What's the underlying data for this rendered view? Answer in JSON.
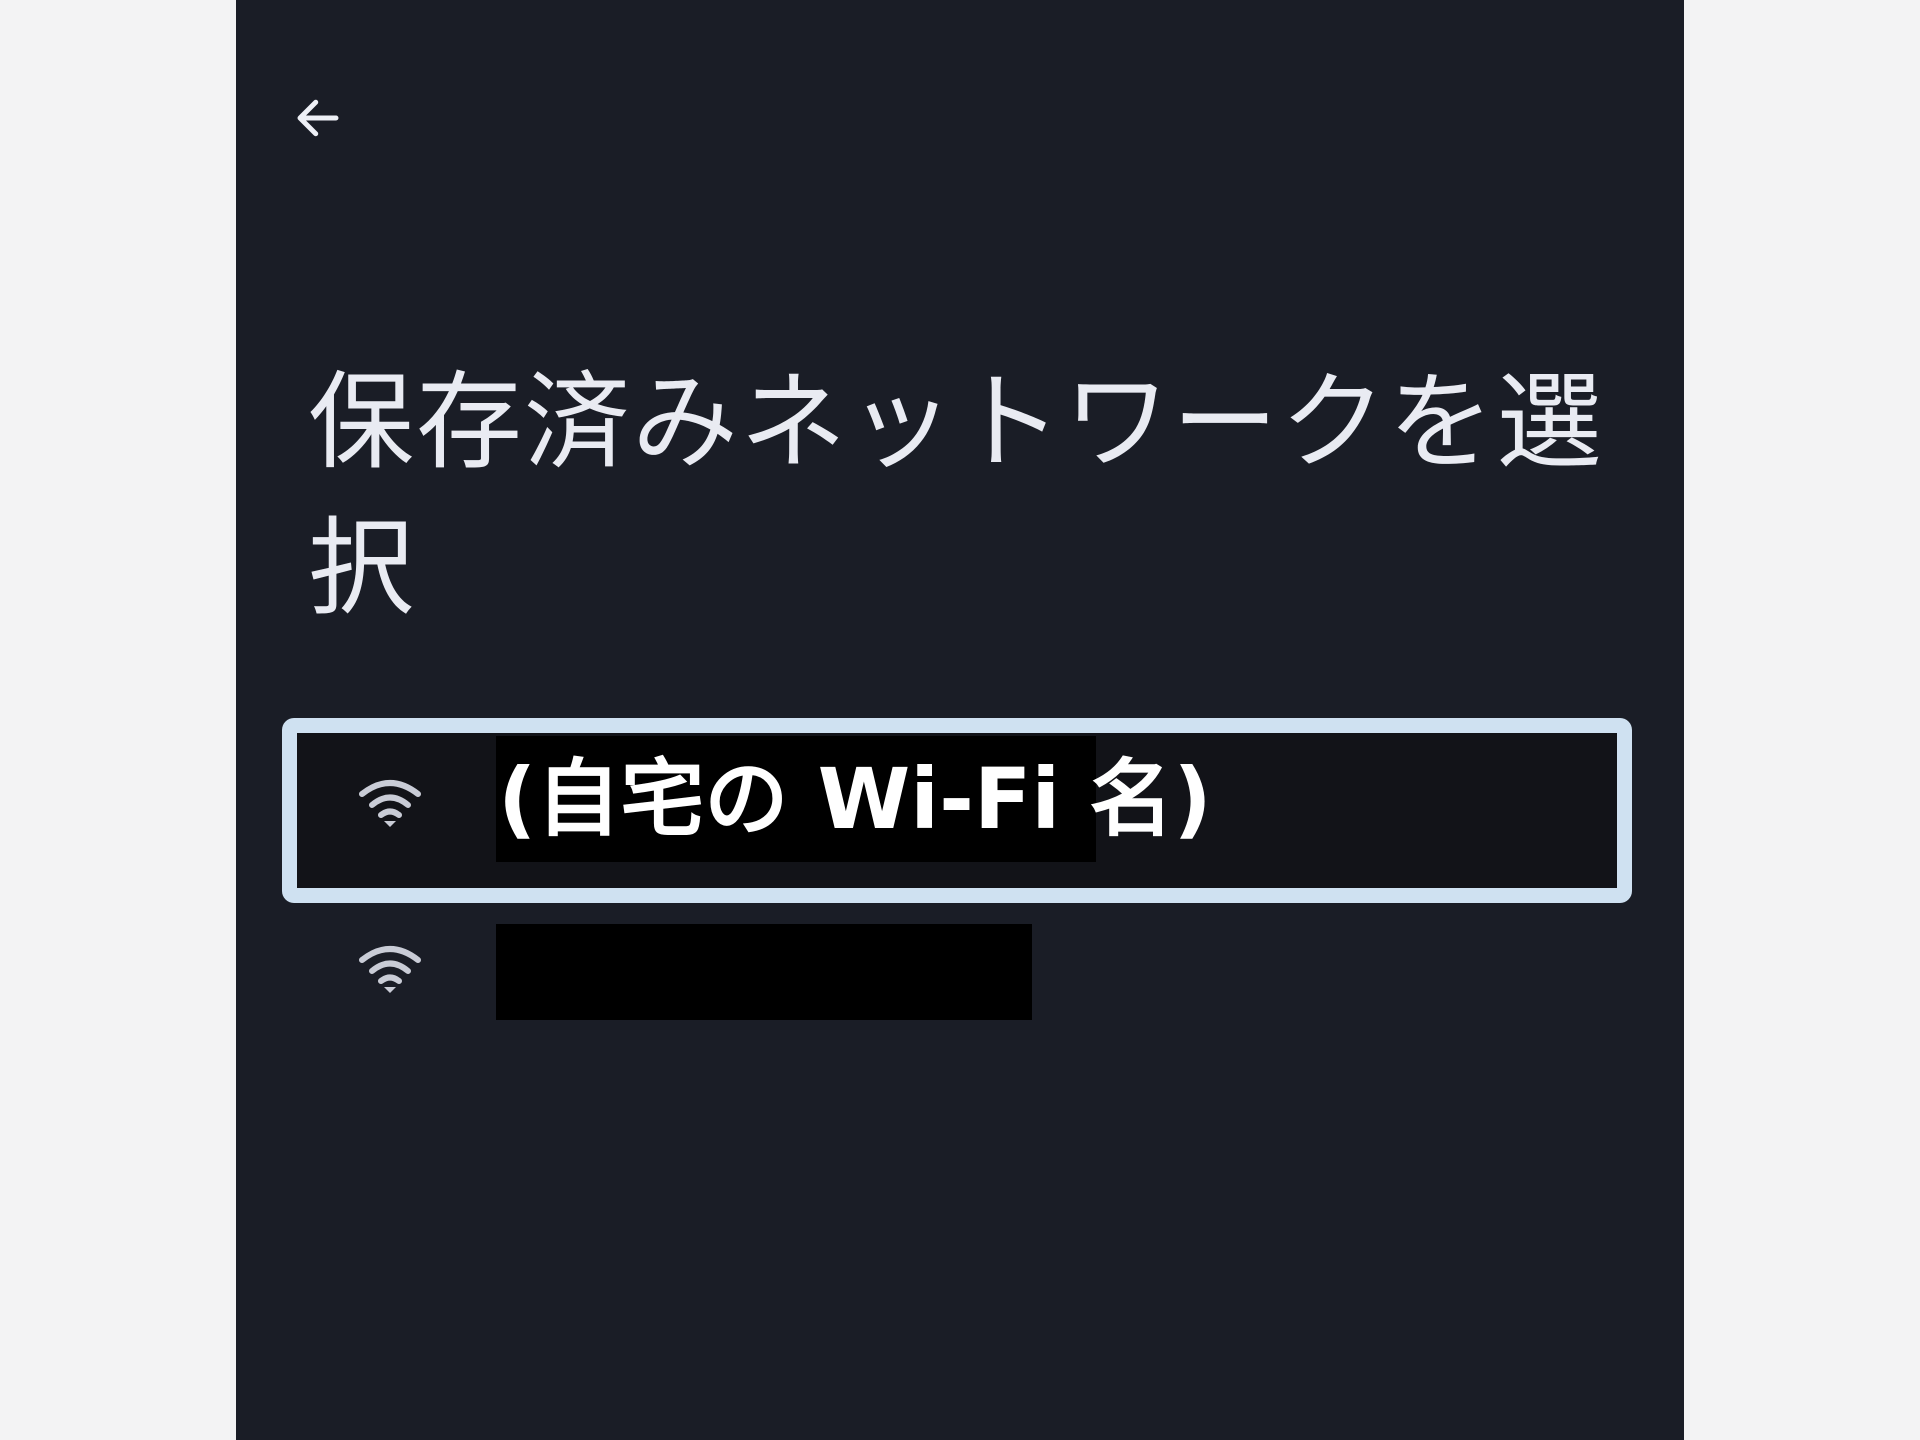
{
  "screen": {
    "title": "保存済みネットワークを選択",
    "back_icon": "arrow-left-icon"
  },
  "networks": [
    {
      "label": "(自宅の Wi-Fi 名)",
      "icon": "wifi-icon",
      "selected": true
    },
    {
      "label": "",
      "icon": "wifi-icon",
      "selected": false,
      "redacted": true
    }
  ],
  "colors": {
    "background": "#1a1d26",
    "highlight_border": "#cfe1f1",
    "text": "#e9ebf2"
  }
}
